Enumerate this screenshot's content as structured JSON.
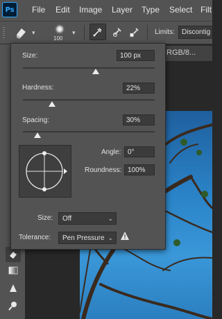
{
  "app": {
    "logo_text": "Ps"
  },
  "menu": {
    "items": [
      "File",
      "Edit",
      "Image",
      "Layer",
      "Type",
      "Select",
      "Filt"
    ]
  },
  "options_bar": {
    "brush_size": "100",
    "limits_label": "Limits:",
    "limits_value": "Discontig"
  },
  "document": {
    "tab_title": "RGB/8..."
  },
  "brush_popup": {
    "size": {
      "label": "Size:",
      "value": "100 px",
      "slider_fraction": 0.55
    },
    "hardness": {
      "label": "Hardness:",
      "value": "22%",
      "slider_fraction": 0.22
    },
    "spacing": {
      "label": "Spacing:",
      "value": "30%",
      "slider_fraction": 0.11
    },
    "angle": {
      "label": "Angle:",
      "value": "0°"
    },
    "roundness": {
      "label": "Roundness:",
      "value": "100%"
    },
    "size_control": {
      "label": "Size:",
      "value": "Off"
    },
    "tolerance": {
      "label": "Tolerance:",
      "value": "Pen Pressure"
    }
  },
  "colors": {
    "panel_bg": "#535353",
    "field_bg": "#3b3b3b",
    "ps_blue": "#31a8ff",
    "warning": "#e0e0e0"
  },
  "icons": [
    "photoshop-logo",
    "eraser-tool-icon",
    "brush-preview-icon",
    "airbrush-eyedropper-icon",
    "sample-continuous-icon",
    "sample-once-icon",
    "sample-swatch-icon",
    "warning-icon",
    "gradient-tool-icon",
    "blur-tool-icon",
    "dodge-tool-icon"
  ]
}
